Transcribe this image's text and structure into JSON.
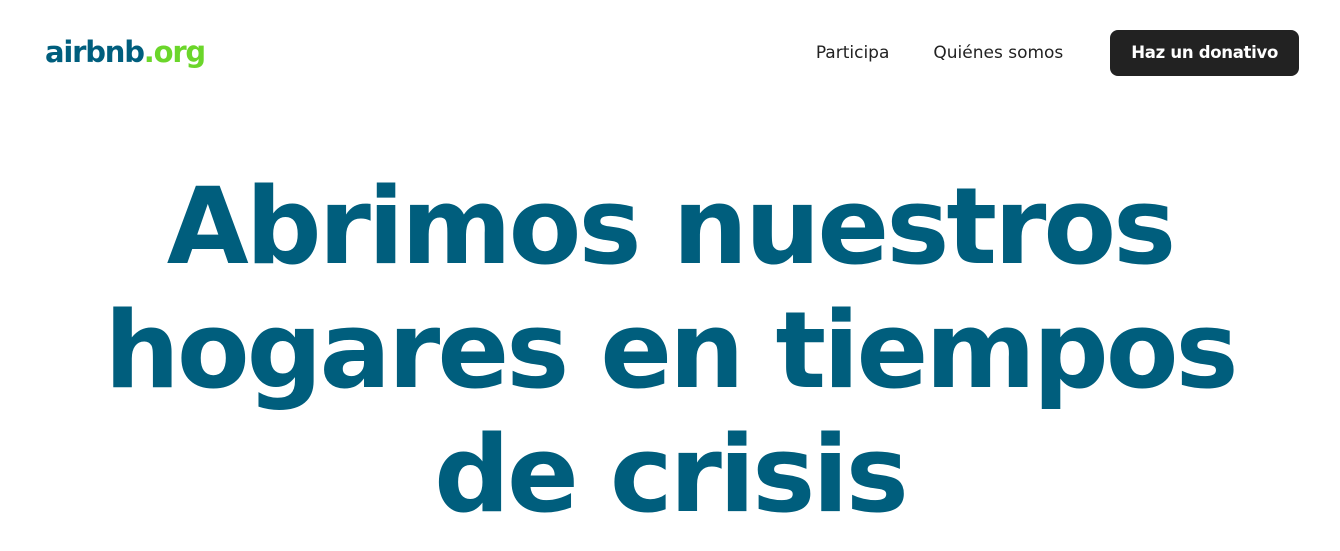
{
  "header": {
    "logo": {
      "brand": "airbnb",
      "tld": ".org"
    },
    "nav": {
      "participa": "Participa",
      "quienes_somos": "Quiénes somos",
      "donate_button": "Haz un donativo"
    }
  },
  "hero": {
    "title_lines": [
      "Abrimos nuestros",
      "hogares en tiempos",
      "de crisis"
    ]
  },
  "colors": {
    "brand_blue": "#005e7d",
    "brand_green": "#6bd62a",
    "text_dark": "#222222",
    "button_bg": "#222222",
    "background": "#ffffff"
  }
}
